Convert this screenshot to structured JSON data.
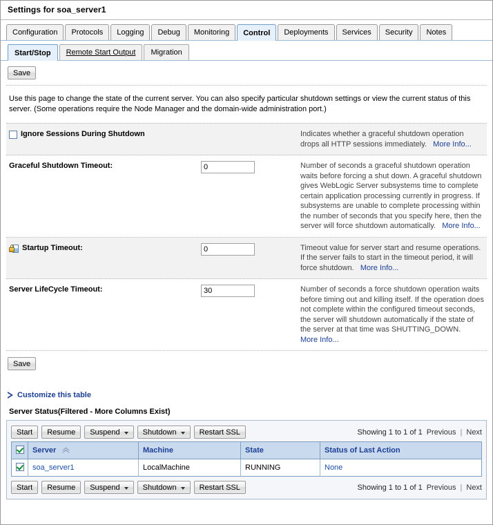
{
  "page": {
    "title": "Settings for soa_server1"
  },
  "primary_tabs": [
    {
      "label": "Configuration",
      "active": false
    },
    {
      "label": "Protocols",
      "active": false
    },
    {
      "label": "Logging",
      "active": false
    },
    {
      "label": "Debug",
      "active": false
    },
    {
      "label": "Monitoring",
      "active": false
    },
    {
      "label": "Control",
      "active": true
    },
    {
      "label": "Deployments",
      "active": false
    },
    {
      "label": "Services",
      "active": false
    },
    {
      "label": "Security",
      "active": false
    },
    {
      "label": "Notes",
      "active": false
    }
  ],
  "secondary_tabs": [
    {
      "label": "Start/Stop",
      "active": true,
      "underline": false
    },
    {
      "label": "Remote Start Output",
      "active": false,
      "underline": true
    },
    {
      "label": "Migration",
      "active": false,
      "underline": false
    }
  ],
  "buttons": {
    "save_top": "Save",
    "save_bottom": "Save"
  },
  "intro": "Use this page to change the state of the current server. You can also specify particular shutdown settings or view the current status of this server. (Some operations require the Node Manager and the domain-wide administration port.)",
  "more_info_label": "More Info...",
  "properties": [
    {
      "label": "Ignore Sessions During Shutdown",
      "type": "checkbox",
      "checked": false,
      "icon": null,
      "description": "Indicates whether a graceful shutdown operation drops all HTTP sessions immediately.",
      "more_info": "More Info..."
    },
    {
      "label": "Graceful Shutdown Timeout:",
      "type": "text",
      "value": "0",
      "icon": null,
      "description": "Number of seconds a graceful shutdown operation waits before forcing a shut down. A graceful shutdown gives WebLogic Server subsystems time to complete certain application processing currently in progress. If subsystems are unable to complete processing within the number of seconds that you specify here, then the server will force shutdown automatically.",
      "more_info": "More Info..."
    },
    {
      "label": "Startup Timeout:",
      "type": "text",
      "value": "0",
      "icon": "lock-icon",
      "description": "Timeout value for server start and resume operations. If the server fails to start in the timeout period, it will force shutdown.",
      "more_info": "More Info..."
    },
    {
      "label": "Server LifeCycle Timeout:",
      "type": "text",
      "value": "30",
      "icon": null,
      "description": "Number of seconds a force shutdown operation waits before timing out and killing itself. If the operation does not complete within the configured timeout seconds, the server will shutdown automatically if the state of the server at that time was SHUTTING_DOWN.",
      "more_info": "More Info..."
    }
  ],
  "customize": {
    "label": "Customize this table",
    "icon": "triangle-right-icon"
  },
  "table": {
    "caption": "Server Status(Filtered - More Columns Exist)",
    "toolbar": [
      {
        "label": "Start",
        "dropdown": false
      },
      {
        "label": "Resume",
        "dropdown": false
      },
      {
        "label": "Suspend",
        "dropdown": true
      },
      {
        "label": "Shutdown",
        "dropdown": true
      },
      {
        "label": "Restart SSL",
        "dropdown": false
      }
    ],
    "pager": {
      "showing": "Showing 1 to 1 of 1",
      "previous": "Previous",
      "separator": "|",
      "next": "Next"
    },
    "columns": [
      "Server",
      "Machine",
      "State",
      "Status of Last Action"
    ],
    "sort_column": "Server",
    "sort_direction": "asc",
    "header_select_all_checked": true,
    "rows": [
      {
        "selected": true,
        "server": "soa_server1",
        "machine": "LocalMachine",
        "state": "RUNNING",
        "status_of_last_action": "None"
      }
    ]
  },
  "colors": {
    "accent_link": "#1c3f94",
    "table_header_bg": "#c9daef",
    "active_tab_bg": "#e6f0fa",
    "row_shaded_bg": "#f2f2f2",
    "panel_border": "#a9bdd2"
  }
}
